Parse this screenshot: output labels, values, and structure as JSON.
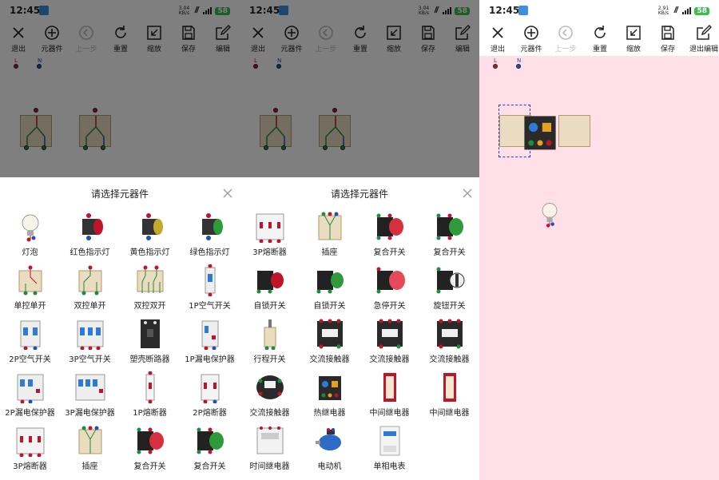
{
  "status": {
    "time": "12:45",
    "speed_1": "3.04",
    "speed_unit": "KB/s",
    "speed_3": "2.91",
    "battery": "58"
  },
  "toolbar": {
    "exit": "退出",
    "components": "元器件",
    "undo": "上一步",
    "reset": "重置",
    "zoom": "缩放",
    "save": "保存",
    "edit": "编辑",
    "exit_edit": "退出编辑"
  },
  "canvas": {
    "live_label": "L",
    "neutral_label": "N"
  },
  "sheet": {
    "title": "请选择元器件"
  },
  "components_1": [
    {
      "label": "灯泡",
      "icon": "bulb"
    },
    {
      "label": "红色指示灯",
      "icon": "lamp-red"
    },
    {
      "label": "黄色指示灯",
      "icon": "lamp-yellow"
    },
    {
      "label": "绿色指示灯",
      "icon": "lamp-green"
    },
    {
      "label": "单控单开",
      "icon": "switch-1"
    },
    {
      "label": "双控单开",
      "icon": "switch-2"
    },
    {
      "label": "双控双开",
      "icon": "switch-3"
    },
    {
      "label": "1P空气开关",
      "icon": "breaker-1p"
    },
    {
      "label": "2P空气开关",
      "icon": "breaker-2p"
    },
    {
      "label": "3P空气开关",
      "icon": "breaker-3p"
    },
    {
      "label": "塑壳断路器",
      "icon": "mccb"
    },
    {
      "label": "1P漏电保护器",
      "icon": "rcd-1p"
    },
    {
      "label": "2P漏电保护器",
      "icon": "rcd-2p"
    },
    {
      "label": "3P漏电保护器",
      "icon": "rcd-3p"
    },
    {
      "label": "1P熔断器",
      "icon": "fuse-1p"
    },
    {
      "label": "2P熔断器",
      "icon": "fuse-2p"
    },
    {
      "label": "3P熔断器",
      "icon": "fuse-3p"
    },
    {
      "label": "插座",
      "icon": "socket"
    },
    {
      "label": "复合开关",
      "icon": "pushbutton-red"
    },
    {
      "label": "复合开关",
      "icon": "pushbutton-green"
    }
  ],
  "components_2": [
    {
      "label": "3P熔断器",
      "icon": "fuse-3p"
    },
    {
      "label": "插座",
      "icon": "socket"
    },
    {
      "label": "复合开关",
      "icon": "pushbutton-red"
    },
    {
      "label": "复合开关",
      "icon": "pushbutton-green"
    },
    {
      "label": "自锁开关",
      "icon": "latch-red"
    },
    {
      "label": "自锁开关",
      "icon": "latch-green"
    },
    {
      "label": "急停开关",
      "icon": "estop"
    },
    {
      "label": "旋钮开关",
      "icon": "knob"
    },
    {
      "label": "行程开关",
      "icon": "limit"
    },
    {
      "label": "交流接触器",
      "icon": "contactor"
    },
    {
      "label": "交流接触器",
      "icon": "contactor"
    },
    {
      "label": "交流接触器",
      "icon": "contactor"
    },
    {
      "label": "交流接触器",
      "icon": "contactor-round"
    },
    {
      "label": "热继电器",
      "icon": "thermal-relay"
    },
    {
      "label": "中间继电器",
      "icon": "relay"
    },
    {
      "label": "中间继电器",
      "icon": "relay"
    },
    {
      "label": "时间继电器",
      "icon": "timer"
    },
    {
      "label": "电动机",
      "icon": "motor"
    },
    {
      "label": "单相电表",
      "icon": "meter"
    }
  ],
  "colors": {
    "live": "#c0142b",
    "neutral": "#1f4fb8",
    "ground": "#1e8c3c",
    "canvas_pink": "#ffe0e8",
    "wood": "#e9dcc0"
  }
}
